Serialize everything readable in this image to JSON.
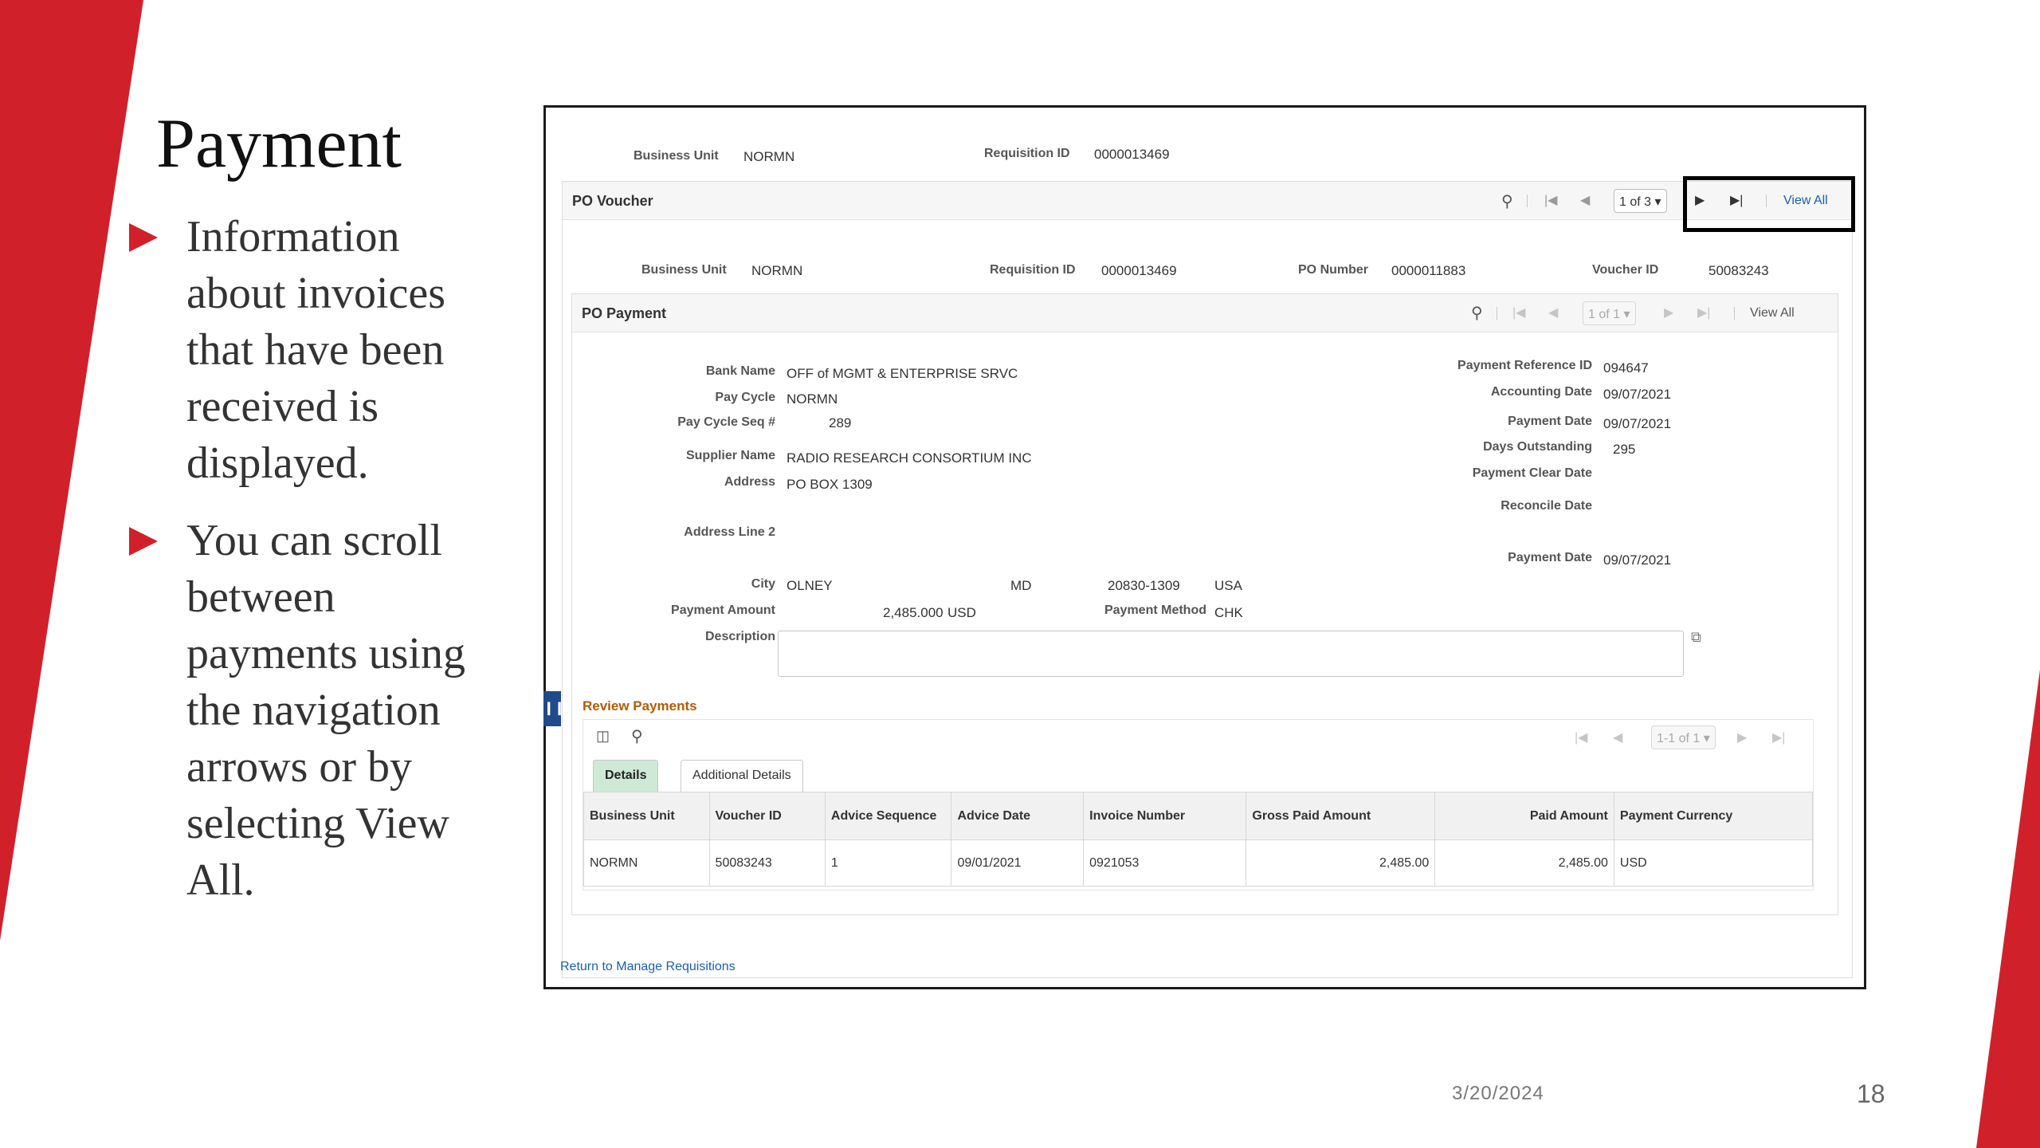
{
  "slide": {
    "title": "Payment",
    "bullets": [
      "Information about invoices that have been received is displayed.",
      "You can scroll between payments using the navigation arrows or by selecting View All."
    ],
    "date": "3/20/2024",
    "page_number": "18",
    "accent_color": "#d0212b"
  },
  "header": {
    "business_unit_label": "Business Unit",
    "business_unit": "NORMN",
    "requisition_id_label": "Requisition ID",
    "requisition_id": "0000013469"
  },
  "po_voucher": {
    "title": "PO Voucher",
    "pager": "1 of 3",
    "view_all": "View All",
    "business_unit_label": "Business Unit",
    "business_unit": "NORMN",
    "requisition_id_label": "Requisition ID",
    "requisition_id": "0000013469",
    "po_number_label": "PO Number",
    "po_number": "0000011883",
    "voucher_id_label": "Voucher ID",
    "voucher_id": "50083243"
  },
  "po_payment": {
    "title": "PO Payment",
    "pager": "1 of 1",
    "view_all": "View All",
    "bank_name_label": "Bank Name",
    "bank_name": "OFF of MGMT & ENTERPRISE SRVC",
    "pay_cycle_label": "Pay Cycle",
    "pay_cycle": "NORMN",
    "pay_cycle_seq_label": "Pay Cycle Seq #",
    "pay_cycle_seq": "289",
    "supplier_name_label": "Supplier Name",
    "supplier_name": "RADIO RESEARCH CONSORTIUM INC",
    "address_label": "Address",
    "address": "PO BOX 1309",
    "address2_label": "Address Line 2",
    "city_label": "City",
    "city": "OLNEY",
    "state": "MD",
    "postal": "20830-1309",
    "country": "USA",
    "payment_amount_label": "Payment Amount",
    "payment_amount": "2,485.000",
    "payment_currency": "USD",
    "payment_method_label": "Payment Method",
    "payment_method": "CHK",
    "description_label": "Description",
    "payment_reference_label": "Payment Reference ID",
    "payment_reference": "094647",
    "accounting_date_label": "Accounting Date",
    "accounting_date": "09/07/2021",
    "payment_date_label": "Payment Date",
    "payment_date": "09/07/2021",
    "days_outstanding_label": "Days Outstanding",
    "days_outstanding": "295",
    "payment_clear_date_label": "Payment Clear Date",
    "reconcile_date_label": "Reconcile Date",
    "payment_date2_label": "Payment Date",
    "payment_date2": "09/07/2021"
  },
  "review_payments": {
    "title": "Review Payments",
    "pager": "1-1 of 1",
    "tabs": [
      "Details",
      "Additional Details"
    ],
    "columns": [
      "Business Unit",
      "Voucher ID",
      "Advice Sequence",
      "Advice Date",
      "Invoice Number",
      "Gross Paid Amount",
      "Paid Amount",
      "Payment Currency"
    ],
    "rows": [
      [
        "NORMN",
        "50083243",
        "1",
        "09/01/2021",
        "0921053",
        "2,485.00",
        "2,485.00",
        "USD"
      ]
    ]
  },
  "footer_link": "Return to Manage Requisitions"
}
